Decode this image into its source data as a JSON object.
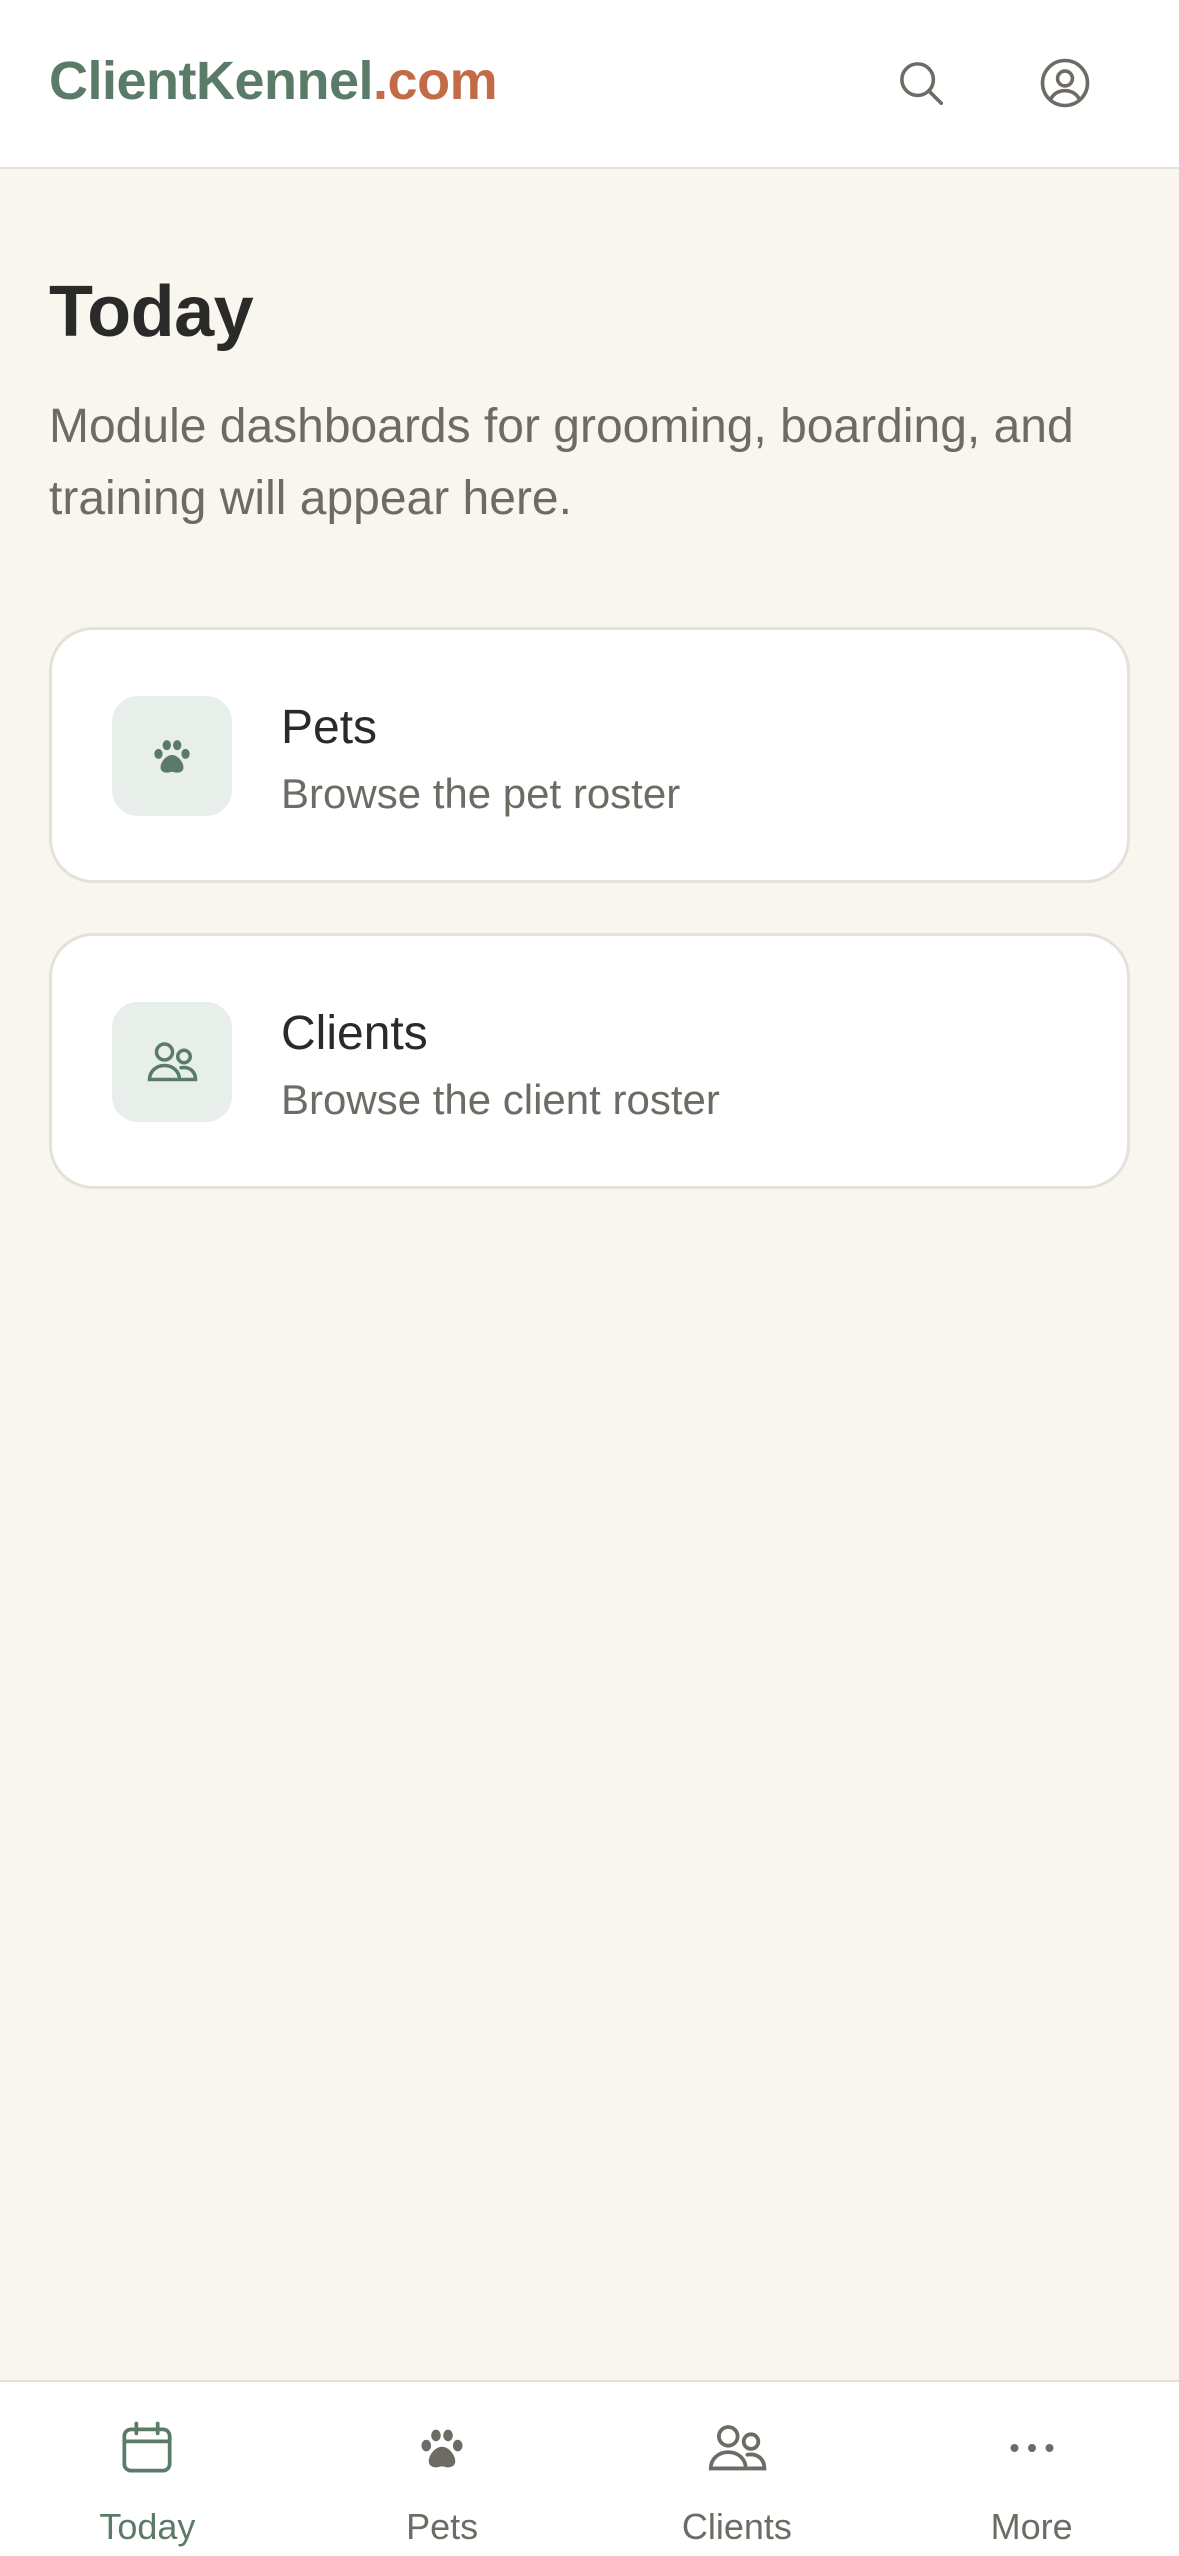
{
  "header": {
    "logo_main": "ClientKennel",
    "logo_tld": ".com",
    "search_icon": "search-icon",
    "account_icon": "account-circle-icon"
  },
  "main": {
    "title": "Today",
    "subtitle": "Module dashboards for grooming, boarding, and training will appear here.",
    "cards": [
      {
        "icon": "paw-icon",
        "title": "Pets",
        "description": "Browse the pet roster"
      },
      {
        "icon": "users-icon",
        "title": "Clients",
        "description": "Browse the client roster"
      }
    ]
  },
  "bottom_nav": {
    "items": [
      {
        "icon": "calendar-icon",
        "label": "Today",
        "active": true
      },
      {
        "icon": "paw-icon",
        "label": "Pets",
        "active": false
      },
      {
        "icon": "users-icon",
        "label": "Clients",
        "active": false
      },
      {
        "icon": "more-dots-icon",
        "label": "More",
        "active": false
      }
    ]
  },
  "colors": {
    "brand_green": "#5b7b69",
    "brand_orange": "#c26b47",
    "background": "#f9f6f0",
    "card_icon_bg": "#e8efea",
    "text_primary": "#2a2a28",
    "text_secondary": "#6e6b65"
  }
}
